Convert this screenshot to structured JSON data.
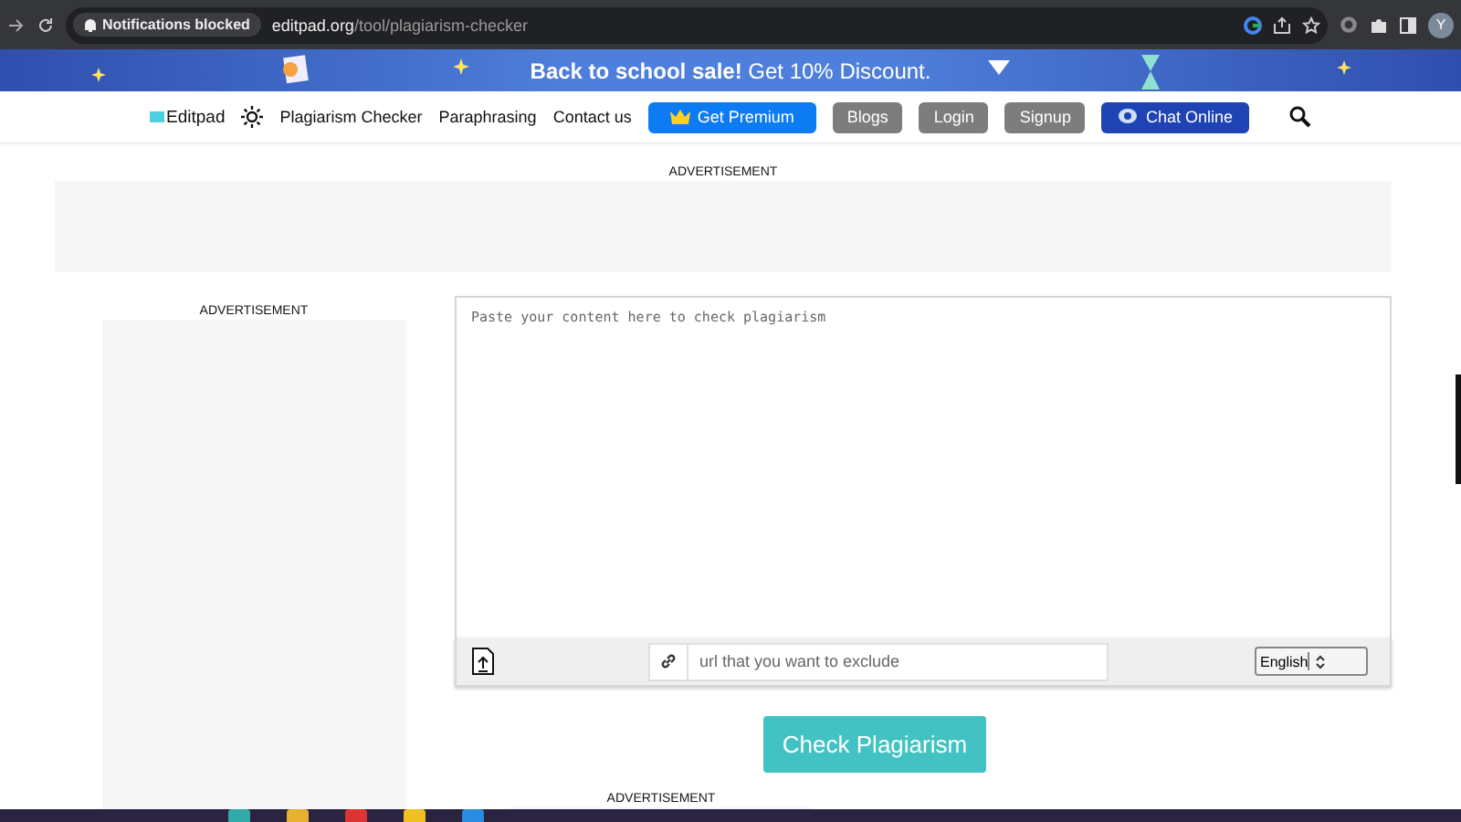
{
  "browser": {
    "notice": "Notifications blocked",
    "url_host": "editpad.org",
    "url_path": "/tool/plagiarism-checker",
    "avatar": "Y"
  },
  "banner": {
    "text": "Back to school sale!",
    "offer": "Get 10% Discount."
  },
  "nav": {
    "logo": "Editpad",
    "links": [
      "Plagiarism Checker",
      "Paraphrasing",
      "Contact us"
    ],
    "buttons": [
      {
        "label": "Get Premium",
        "kind": "premium"
      },
      {
        "label": "Blogs",
        "kind": "grey"
      },
      {
        "label": "Login",
        "kind": "grey"
      },
      {
        "label": "Signup",
        "kind": "grey"
      },
      {
        "label": "Chat Online",
        "kind": "chat"
      }
    ]
  },
  "top_ad": {
    "label": "ADVERTISEMENT"
  },
  "side_ad": {
    "label": "ADVERTISEMENT"
  },
  "editor": {
    "placeholder": "Paste your content here to check plagiarism",
    "exclude_placeholder": "url that you want to exclude",
    "language": "English"
  },
  "check_button": "Check Plagiarism",
  "bottom_ad": {
    "label": "ADVERTISEMENT"
  }
}
